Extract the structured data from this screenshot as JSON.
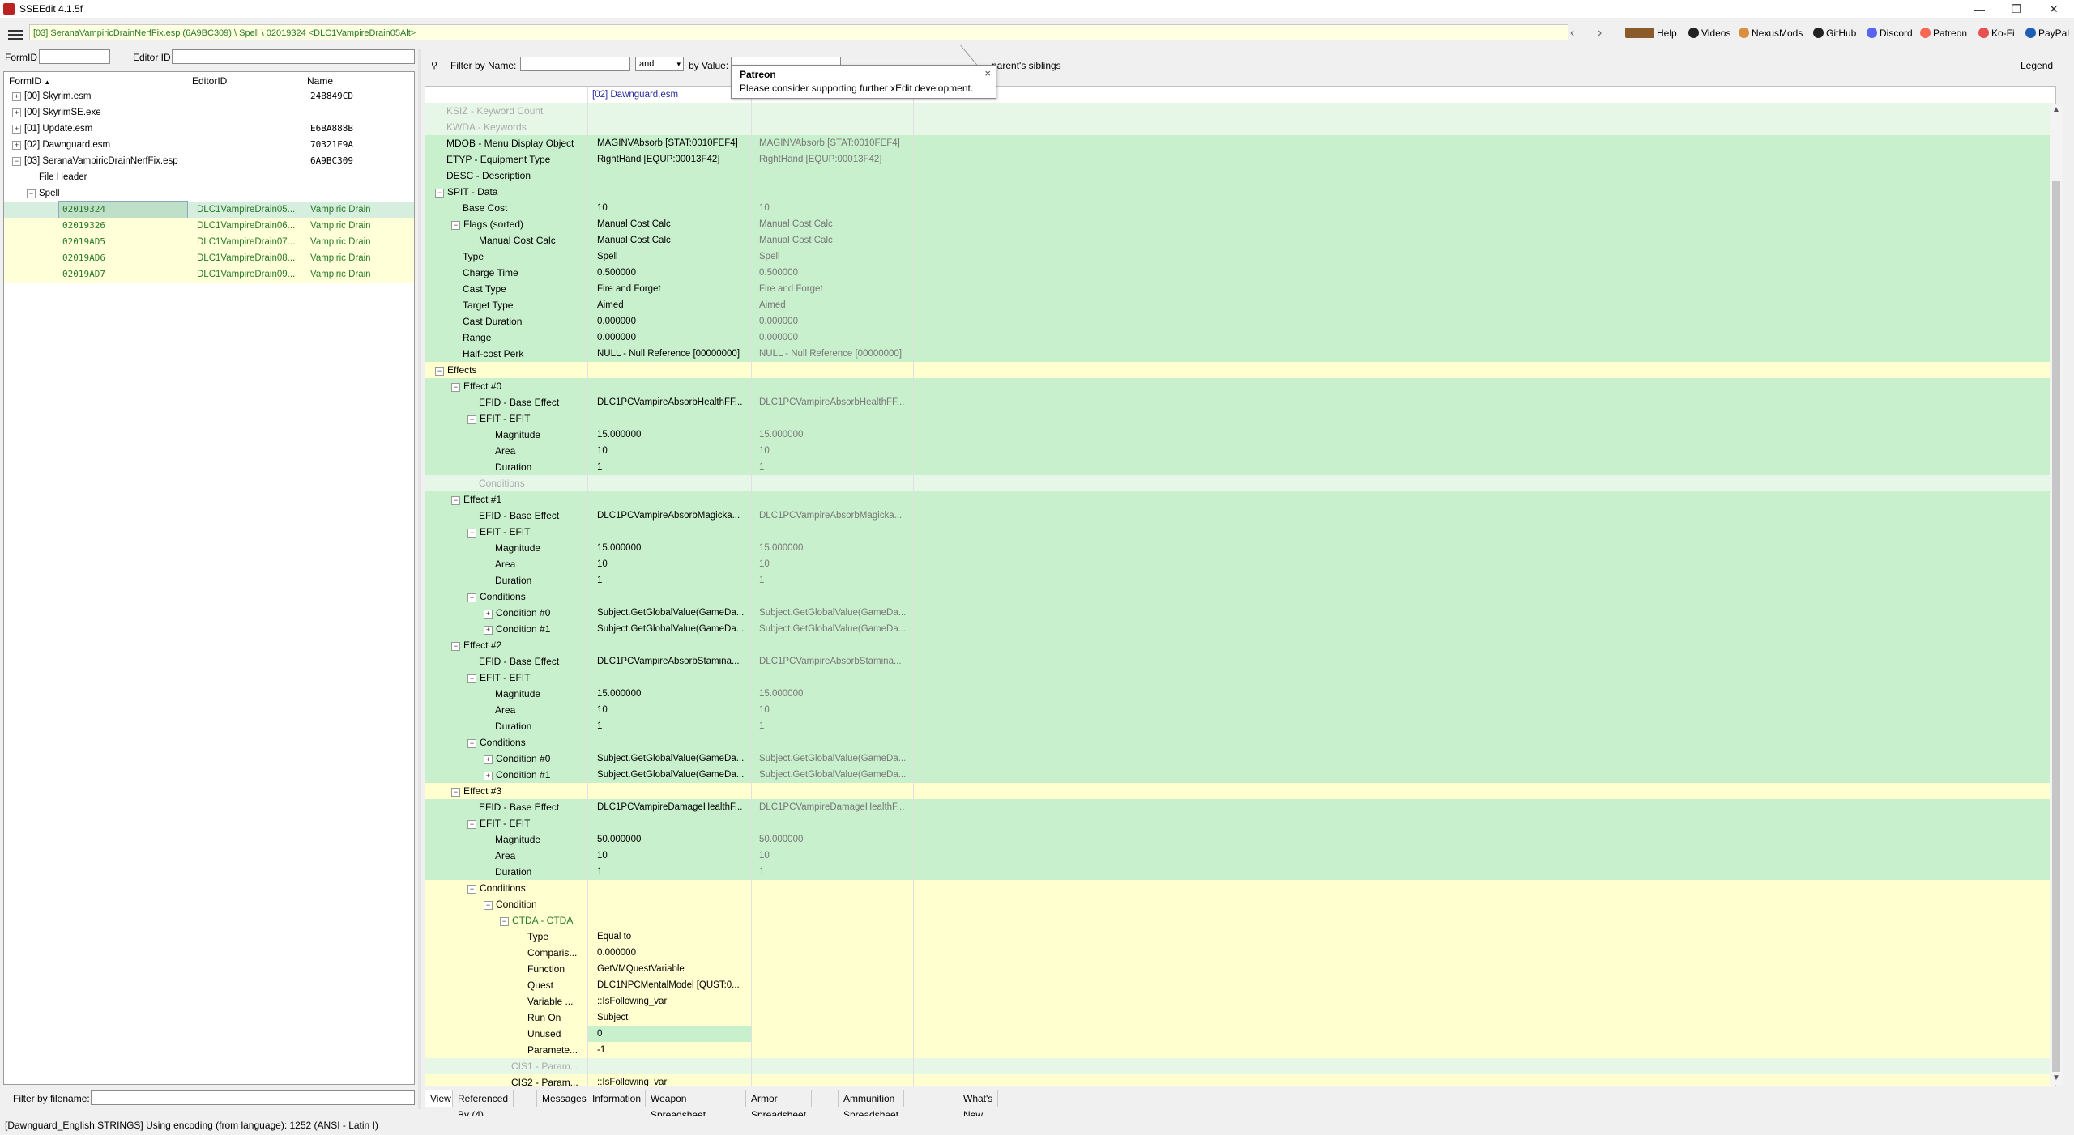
{
  "window": {
    "title": "SSEEdit 4.1.5f",
    "controls": [
      "—",
      "❐",
      "✕"
    ]
  },
  "path": "[03] SeranaVampiricDrainNerfFix.esp (6A9BC309) \\ Spell \\ 02019324 <DLC1VampireDrain05Alt>",
  "toplinks": [
    {
      "label": "Help",
      "icon": "book-icon",
      "color": "#8a5a2a"
    },
    {
      "label": "Videos",
      "icon": "videos-icon",
      "color": "#222222"
    },
    {
      "label": "NexusMods",
      "icon": "nexusmods-icon",
      "color": "#d98f40"
    },
    {
      "label": "GitHub",
      "icon": "github-icon",
      "color": "#222222"
    },
    {
      "label": "Discord",
      "icon": "discord-icon",
      "color": "#5865f2"
    },
    {
      "label": "Patreon",
      "icon": "patreon-icon",
      "color": "#f96854"
    },
    {
      "label": "Ko-Fi",
      "icon": "kofi-icon",
      "color": "#e8504f"
    },
    {
      "label": "PayPal",
      "icon": "paypal-icon",
      "color": "#1f5fb3"
    }
  ],
  "left": {
    "formid_label": "FormID",
    "editorid_label": "Editor ID",
    "columns": [
      "FormID",
      "EditorID",
      "Name"
    ],
    "sort_indicator": "▲",
    "tree": [
      {
        "exp": "+",
        "label": "[00] Skyrim.esm",
        "name": "24B849CD",
        "indent": 0,
        "bg": "white"
      },
      {
        "exp": "+",
        "label": "[00] SkyrimSE.exe",
        "name": "",
        "indent": 0,
        "bg": "white"
      },
      {
        "exp": "+",
        "label": "[01] Update.esm",
        "name": "E6BA888B",
        "indent": 0,
        "bg": "white"
      },
      {
        "exp": "+",
        "label": "[02] Dawnguard.esm",
        "name": "70321F9A",
        "indent": 0,
        "bg": "white"
      },
      {
        "exp": "−",
        "label": "[03] SeranaVampiricDrainNerfFix.esp",
        "name": "6A9BC309",
        "indent": 0,
        "bg": "white"
      },
      {
        "exp": "",
        "label": "File Header",
        "name": "",
        "indent": 1,
        "bg": "white"
      },
      {
        "exp": "−",
        "label": "Spell",
        "name": "",
        "indent": 1,
        "bg": "white"
      }
    ],
    "records": [
      {
        "formid": "02019324",
        "editorid": "DLC1VampireDrain05...",
        "name": "Vampiric Drain",
        "selected": true
      },
      {
        "formid": "02019326",
        "editorid": "DLC1VampireDrain06...",
        "name": "Vampiric Drain",
        "selected": false
      },
      {
        "formid": "02019AD5",
        "editorid": "DLC1VampireDrain07...",
        "name": "Vampiric Drain",
        "selected": false
      },
      {
        "formid": "02019AD6",
        "editorid": "DLC1VampireDrain08...",
        "name": "Vampiric Drain",
        "selected": false
      },
      {
        "formid": "02019AD7",
        "editorid": "DLC1VampireDrain09...",
        "name": "Vampiric Drain",
        "selected": false
      }
    ],
    "filter_by_filename_label": "Filter by filename:"
  },
  "right": {
    "filter_name_label": "Filter by Name:",
    "and_value": "and",
    "by_value_label": "by Value:",
    "parents_siblings": "parent's siblings",
    "legend": "Legend",
    "column_header": "[02] Dawnguard.esm",
    "rows": [
      {
        "indent": 0,
        "exp": "",
        "label": "KSIZ - Keyword Count",
        "v1": "",
        "v2": "",
        "bg": "pale",
        "dim": true
      },
      {
        "indent": 0,
        "exp": "",
        "label": "KWDA - Keywords",
        "v1": "",
        "v2": "",
        "bg": "pale",
        "dim": true
      },
      {
        "indent": 0,
        "exp": "",
        "label": "MDOB - Menu Display Object",
        "v1": "MAGINVAbsorb [STAT:0010FEF4]",
        "v2": "MAGINVAbsorb [STAT:0010FEF4]",
        "bg": "green"
      },
      {
        "indent": 0,
        "exp": "",
        "label": "ETYP - Equipment Type",
        "v1": "RightHand [EQUP:00013F42]",
        "v2": "RightHand [EQUP:00013F42]",
        "bg": "green"
      },
      {
        "indent": 0,
        "exp": "",
        "label": "DESC - Description",
        "v1": "",
        "v2": "",
        "bg": "green"
      },
      {
        "indent": 0,
        "exp": "−",
        "label": "SPIT - Data",
        "v1": "",
        "v2": "",
        "bg": "green"
      },
      {
        "indent": 1,
        "exp": "",
        "label": "Base Cost",
        "v1": "10",
        "v2": "10",
        "bg": "green"
      },
      {
        "indent": 1,
        "exp": "−",
        "label": "Flags (sorted)",
        "v1": "Manual Cost Calc",
        "v2": "Manual Cost Calc",
        "bg": "green"
      },
      {
        "indent": 2,
        "exp": "",
        "label": "Manual Cost Calc",
        "v1": "Manual Cost Calc",
        "v2": "Manual Cost Calc",
        "bg": "green"
      },
      {
        "indent": 1,
        "exp": "",
        "label": "Type",
        "v1": "Spell",
        "v2": "Spell",
        "bg": "green"
      },
      {
        "indent": 1,
        "exp": "",
        "label": "Charge Time",
        "v1": "0.500000",
        "v2": "0.500000",
        "bg": "green"
      },
      {
        "indent": 1,
        "exp": "",
        "label": "Cast Type",
        "v1": "Fire and Forget",
        "v2": "Fire and Forget",
        "bg": "green"
      },
      {
        "indent": 1,
        "exp": "",
        "label": "Target Type",
        "v1": "Aimed",
        "v2": "Aimed",
        "bg": "green"
      },
      {
        "indent": 1,
        "exp": "",
        "label": "Cast Duration",
        "v1": "0.000000",
        "v2": "0.000000",
        "bg": "green"
      },
      {
        "indent": 1,
        "exp": "",
        "label": "Range",
        "v1": "0.000000",
        "v2": "0.000000",
        "bg": "green"
      },
      {
        "indent": 1,
        "exp": "",
        "label": "Half-cost Perk",
        "v1": "NULL - Null Reference [00000000]",
        "v2": "NULL - Null Reference [00000000]",
        "bg": "green"
      },
      {
        "indent": 0,
        "exp": "−",
        "label": "Effects",
        "v1": "",
        "v2": "",
        "bg": "yellow"
      },
      {
        "indent": 1,
        "exp": "−",
        "label": "Effect #0",
        "v1": "",
        "v2": "",
        "bg": "green"
      },
      {
        "indent": 2,
        "exp": "",
        "label": "EFID - Base Effect",
        "v1": "DLC1PCVampireAbsorbHealthFF...",
        "v2": "DLC1PCVampireAbsorbHealthFF...",
        "bg": "green"
      },
      {
        "indent": 2,
        "exp": "−",
        "label": "EFIT - EFIT",
        "v1": "",
        "v2": "",
        "bg": "green"
      },
      {
        "indent": 3,
        "exp": "",
        "label": "Magnitude",
        "v1": "15.000000",
        "v2": "15.000000",
        "bg": "green"
      },
      {
        "indent": 3,
        "exp": "",
        "label": "Area",
        "v1": "10",
        "v2": "10",
        "bg": "green"
      },
      {
        "indent": 3,
        "exp": "",
        "label": "Duration",
        "v1": "1",
        "v2": "1",
        "bg": "green"
      },
      {
        "indent": 2,
        "exp": "",
        "label": "Conditions",
        "v1": "",
        "v2": "",
        "bg": "pale",
        "dim": true
      },
      {
        "indent": 1,
        "exp": "−",
        "label": "Effect #1",
        "v1": "",
        "v2": "",
        "bg": "green"
      },
      {
        "indent": 2,
        "exp": "",
        "label": "EFID - Base Effect",
        "v1": "DLC1PCVampireAbsorbMagicka...",
        "v2": "DLC1PCVampireAbsorbMagicka...",
        "bg": "green"
      },
      {
        "indent": 2,
        "exp": "−",
        "label": "EFIT - EFIT",
        "v1": "",
        "v2": "",
        "bg": "green"
      },
      {
        "indent": 3,
        "exp": "",
        "label": "Magnitude",
        "v1": "15.000000",
        "v2": "15.000000",
        "bg": "green"
      },
      {
        "indent": 3,
        "exp": "",
        "label": "Area",
        "v1": "10",
        "v2": "10",
        "bg": "green"
      },
      {
        "indent": 3,
        "exp": "",
        "label": "Duration",
        "v1": "1",
        "v2": "1",
        "bg": "green"
      },
      {
        "indent": 2,
        "exp": "−",
        "label": "Conditions",
        "v1": "",
        "v2": "",
        "bg": "green"
      },
      {
        "indent": 3,
        "exp": "+",
        "label": "Condition #0",
        "v1": "Subject.GetGlobalValue(GameDa...",
        "v2": "Subject.GetGlobalValue(GameDa...",
        "bg": "green"
      },
      {
        "indent": 3,
        "exp": "+",
        "label": "Condition #1",
        "v1": "Subject.GetGlobalValue(GameDa...",
        "v2": "Subject.GetGlobalValue(GameDa...",
        "bg": "green"
      },
      {
        "indent": 1,
        "exp": "−",
        "label": "Effect #2",
        "v1": "",
        "v2": "",
        "bg": "green"
      },
      {
        "indent": 2,
        "exp": "",
        "label": "EFID - Base Effect",
        "v1": "DLC1PCVampireAbsorbStamina...",
        "v2": "DLC1PCVampireAbsorbStamina...",
        "bg": "green"
      },
      {
        "indent": 2,
        "exp": "−",
        "label": "EFIT - EFIT",
        "v1": "",
        "v2": "",
        "bg": "green"
      },
      {
        "indent": 3,
        "exp": "",
        "label": "Magnitude",
        "v1": "15.000000",
        "v2": "15.000000",
        "bg": "green"
      },
      {
        "indent": 3,
        "exp": "",
        "label": "Area",
        "v1": "10",
        "v2": "10",
        "bg": "green"
      },
      {
        "indent": 3,
        "exp": "",
        "label": "Duration",
        "v1": "1",
        "v2": "1",
        "bg": "green"
      },
      {
        "indent": 2,
        "exp": "−",
        "label": "Conditions",
        "v1": "",
        "v2": "",
        "bg": "green"
      },
      {
        "indent": 3,
        "exp": "+",
        "label": "Condition #0",
        "v1": "Subject.GetGlobalValue(GameDa...",
        "v2": "Subject.GetGlobalValue(GameDa...",
        "bg": "green"
      },
      {
        "indent": 3,
        "exp": "+",
        "label": "Condition #1",
        "v1": "Subject.GetGlobalValue(GameDa...",
        "v2": "Subject.GetGlobalValue(GameDa...",
        "bg": "green"
      },
      {
        "indent": 1,
        "exp": "−",
        "label": "Effect #3",
        "v1": "",
        "v2": "",
        "bg": "yellow"
      },
      {
        "indent": 2,
        "exp": "",
        "label": "EFID - Base Effect",
        "v1": "DLC1PCVampireDamageHealthF...",
        "v2": "DLC1PCVampireDamageHealthF...",
        "bg": "green"
      },
      {
        "indent": 2,
        "exp": "−",
        "label": "EFIT - EFIT",
        "v1": "",
        "v2": "",
        "bg": "green"
      },
      {
        "indent": 3,
        "exp": "",
        "label": "Magnitude",
        "v1": "50.000000",
        "v2": "50.000000",
        "bg": "green"
      },
      {
        "indent": 3,
        "exp": "",
        "label": "Area",
        "v1": "10",
        "v2": "10",
        "bg": "green"
      },
      {
        "indent": 3,
        "exp": "",
        "label": "Duration",
        "v1": "1",
        "v2": "1",
        "bg": "green"
      },
      {
        "indent": 2,
        "exp": "−",
        "label": "Conditions",
        "v1": "",
        "v2": "",
        "bg": "yellow"
      },
      {
        "indent": 3,
        "exp": "−",
        "label": "Condition",
        "v1": "",
        "v2": "",
        "bg": "yellow"
      },
      {
        "indent": 4,
        "exp": "−",
        "label": "CTDA - CTDA",
        "v1": "",
        "v2": "",
        "bg": "yellow",
        "color": "#2a7a2a"
      },
      {
        "indent": 5,
        "exp": "",
        "label": "Type",
        "v1": "Equal to",
        "v2": "",
        "bg": "yellow"
      },
      {
        "indent": 5,
        "exp": "",
        "label": "Comparis...",
        "v1": "0.000000",
        "v2": "",
        "bg": "yellow"
      },
      {
        "indent": 5,
        "exp": "",
        "label": "Function",
        "v1": "GetVMQuestVariable",
        "v2": "",
        "bg": "yellow"
      },
      {
        "indent": 5,
        "exp": "",
        "label": "Quest",
        "v1": "DLC1NPCMentalModel [QUST:0...",
        "v2": "",
        "bg": "yellow"
      },
      {
        "indent": 5,
        "exp": "",
        "label": "Variable ...",
        "v1": "::IsFollowing_var",
        "v2": "",
        "bg": "yellow"
      },
      {
        "indent": 5,
        "exp": "",
        "label": "Run On",
        "v1": "Subject",
        "v2": "",
        "bg": "yellow"
      },
      {
        "indent": 5,
        "exp": "",
        "label": "Unused",
        "v1": "0",
        "v2": "",
        "bg": "greenrow"
      },
      {
        "indent": 5,
        "exp": "",
        "label": "Paramete...",
        "v1": "-1",
        "v2": "",
        "bg": "yellow"
      },
      {
        "indent": 4,
        "exp": "",
        "label": "CIS1 - Param...",
        "v1": "",
        "v2": "",
        "bg": "pale",
        "dim": true
      },
      {
        "indent": 4,
        "exp": "",
        "label": "CIS2 - Param...",
        "v1": "::IsFollowing_var",
        "v2": "",
        "bg": "yellow"
      }
    ]
  },
  "tabs": [
    "View",
    "Referenced By (4)",
    "Messages",
    "Information",
    "Weapon Spreadsheet",
    "Armor Spreadsheet",
    "Ammunition Spreadsheet",
    "What's New"
  ],
  "status": "[Dawnguard_English.STRINGS] Using encoding (from language): 1252  (ANSI - Latin I)",
  "tooltip": {
    "title": "Patreon",
    "body": "Please consider supporting further xEdit development.",
    "close": "×"
  }
}
